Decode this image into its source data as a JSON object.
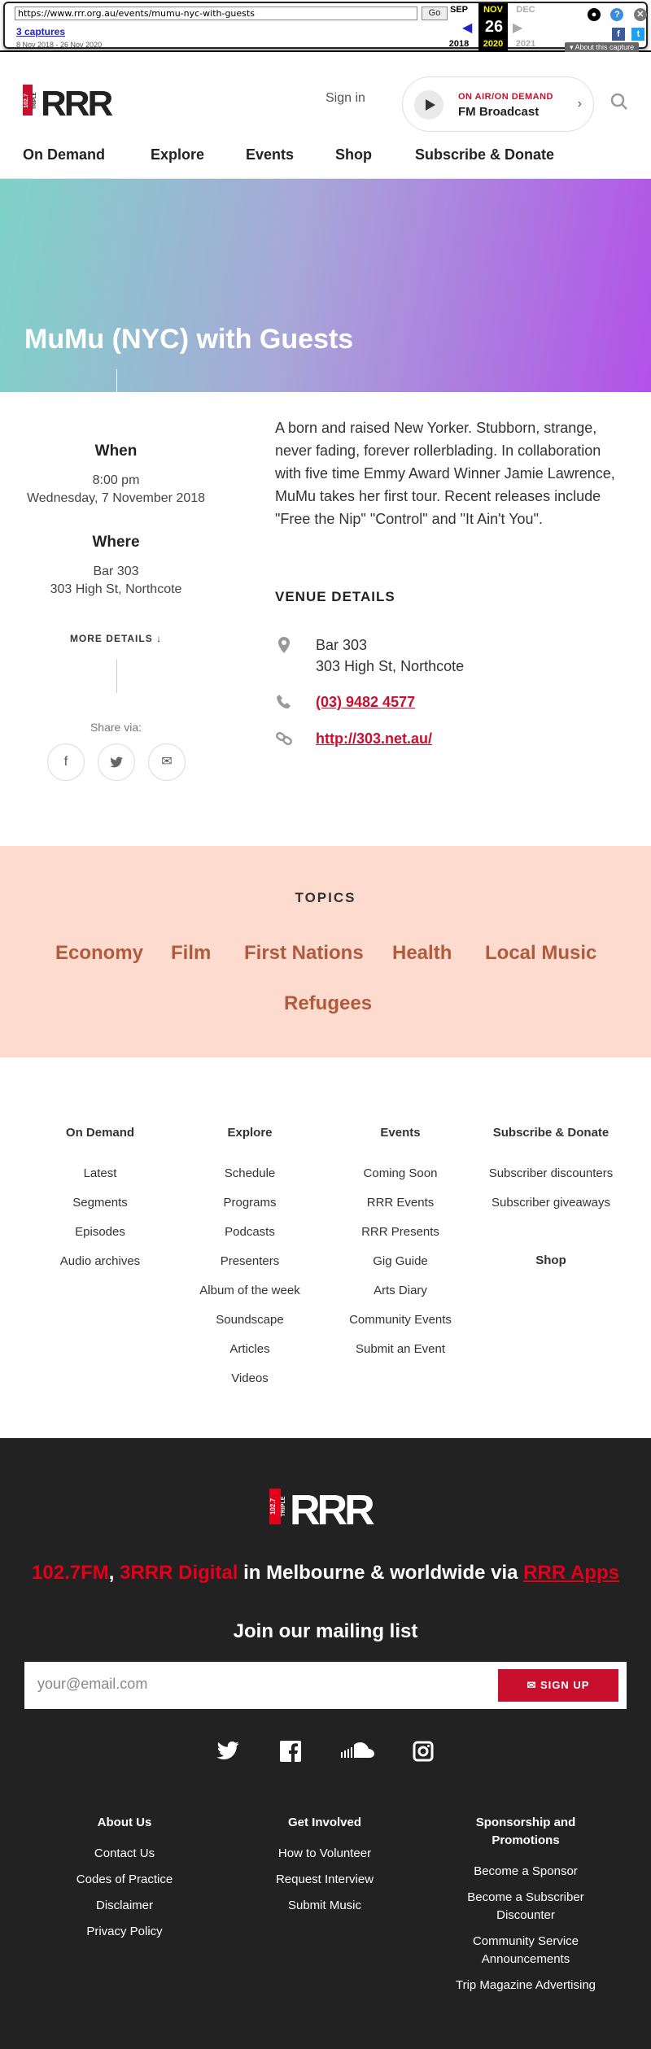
{
  "wayback": {
    "url": "https://www.rrr.org.au/events/mumu-nyc-with-guests",
    "go_label": "Go",
    "captures": "3 captures",
    "range": "8 Nov 2018 - 26 Nov 2020",
    "months": [
      "SEP",
      "NOV",
      "DEC"
    ],
    "day": "26",
    "years": [
      "2018",
      "2020",
      "2021"
    ],
    "about": "About this capture"
  },
  "header": {
    "signin": "Sign in",
    "onair_label": "ON AIR/ON DEMAND",
    "onair_station": "FM Broadcast",
    "nav": [
      "On Demand",
      "Explore",
      "Events",
      "Shop",
      "Subscribe & Donate"
    ],
    "logo_text": "RRR"
  },
  "hero": {
    "title": "MuMu (NYC) with Guests"
  },
  "event": {
    "when_label": "When",
    "time": "8:00 pm",
    "date": "Wednesday, 7 November 2018",
    "where_label": "Where",
    "venue_name": "Bar 303",
    "venue_address": "303 High St, Northcote",
    "more_details": "MORE DETAILS",
    "share_label": "Share via:",
    "description": "A born and raised New Yorker. Stubborn, strange, never fading, forever rollerblading. In collaboration with five time Emmy Award Winner Jamie Lawrence, MuMu takes her first tour. Recent releases include \"Free the Nip\" \"Control\" and \"It Ain't You\".",
    "venue_details_heading": "VENUE DETAILS",
    "venue_phone": "(03) 9482 4577",
    "venue_url": "http://303.net.au/"
  },
  "topics": {
    "heading": "TOPICS",
    "items": [
      "Economy",
      "Film",
      "First Nations",
      "Health",
      "Local Music",
      "Refugees"
    ]
  },
  "footer_links": {
    "on_demand": {
      "heading": "On Demand",
      "items": [
        "Latest",
        "Segments",
        "Episodes",
        "Audio archives"
      ]
    },
    "explore": {
      "heading": "Explore",
      "items": [
        "Schedule",
        "Programs",
        "Podcasts",
        "Presenters",
        "Album of the week",
        "Soundscape",
        "Articles",
        "Videos"
      ]
    },
    "events": {
      "heading": "Events",
      "items": [
        "Coming Soon",
        "RRR Events",
        "RRR Presents",
        "Gig Guide",
        "Arts Diary",
        "Community Events",
        "Submit an Event"
      ]
    },
    "subscribe": {
      "heading": "Subscribe & Donate",
      "items": [
        "Subscriber discounters",
        "Subscriber giveaways"
      ]
    },
    "shop": "Shop"
  },
  "dark_footer": {
    "freq": "102.7FM",
    "comma": ",",
    "digital": "3RRR Digital",
    "middle": "in Melbourne & worldwide via",
    "apps": "RRR Apps",
    "join": "Join our mailing list",
    "email_placeholder": "your@email.com",
    "signup": "SIGN UP",
    "about": {
      "heading": "About Us",
      "items": [
        "Contact Us",
        "Codes of Practice",
        "Disclaimer",
        "Privacy Policy"
      ]
    },
    "involved": {
      "heading": "Get Involved",
      "items": [
        "How to Volunteer",
        "Request Interview",
        "Submit Music"
      ]
    },
    "sponsor": {
      "heading": "Sponsorship and Promotions",
      "items": [
        "Become a Sponsor",
        "Become a Subscriber Discounter",
        "Community Service Announcements",
        "Trip Magazine Advertising"
      ]
    }
  },
  "colors": {
    "brand_red": "#c8102e",
    "topic_brown": "#b05b3c",
    "topics_bg": "#fedbcf",
    "footer_bg": "#222222"
  }
}
